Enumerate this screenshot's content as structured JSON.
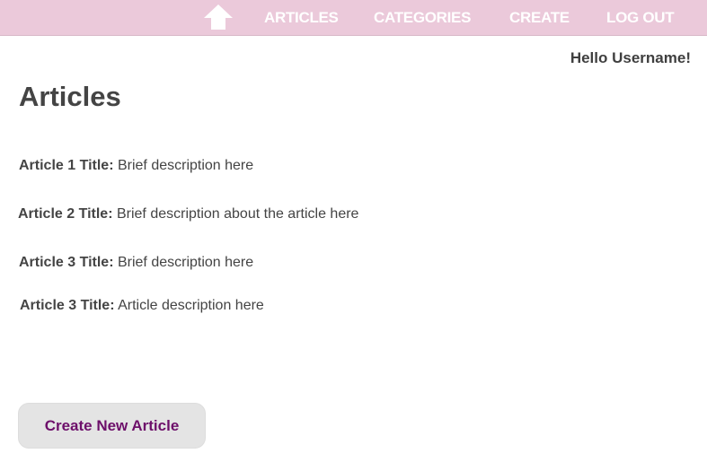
{
  "nav": {
    "home_icon": "home-up-arrow-icon",
    "items": [
      {
        "label": "ARTICLES"
      },
      {
        "label": "CATEGORIES"
      },
      {
        "label": "CREATE"
      },
      {
        "label": "LOG OUT"
      }
    ],
    "bar_color": "#ebc9da"
  },
  "user": {
    "greeting": "Hello Username!"
  },
  "main": {
    "title": "Articles",
    "articles": [
      {
        "title": "Article 1 Title:",
        "description": "Brief description here"
      },
      {
        "title": "Article 2 Title:",
        "description": "Brief description about the article here"
      },
      {
        "title": "Article 3 Title:",
        "description": "Brief description here"
      },
      {
        "title": "Article 3 Title:",
        "description": "Article description here"
      }
    ],
    "create_button_label": "Create New Article",
    "button_text_color": "#6d0f6a"
  }
}
